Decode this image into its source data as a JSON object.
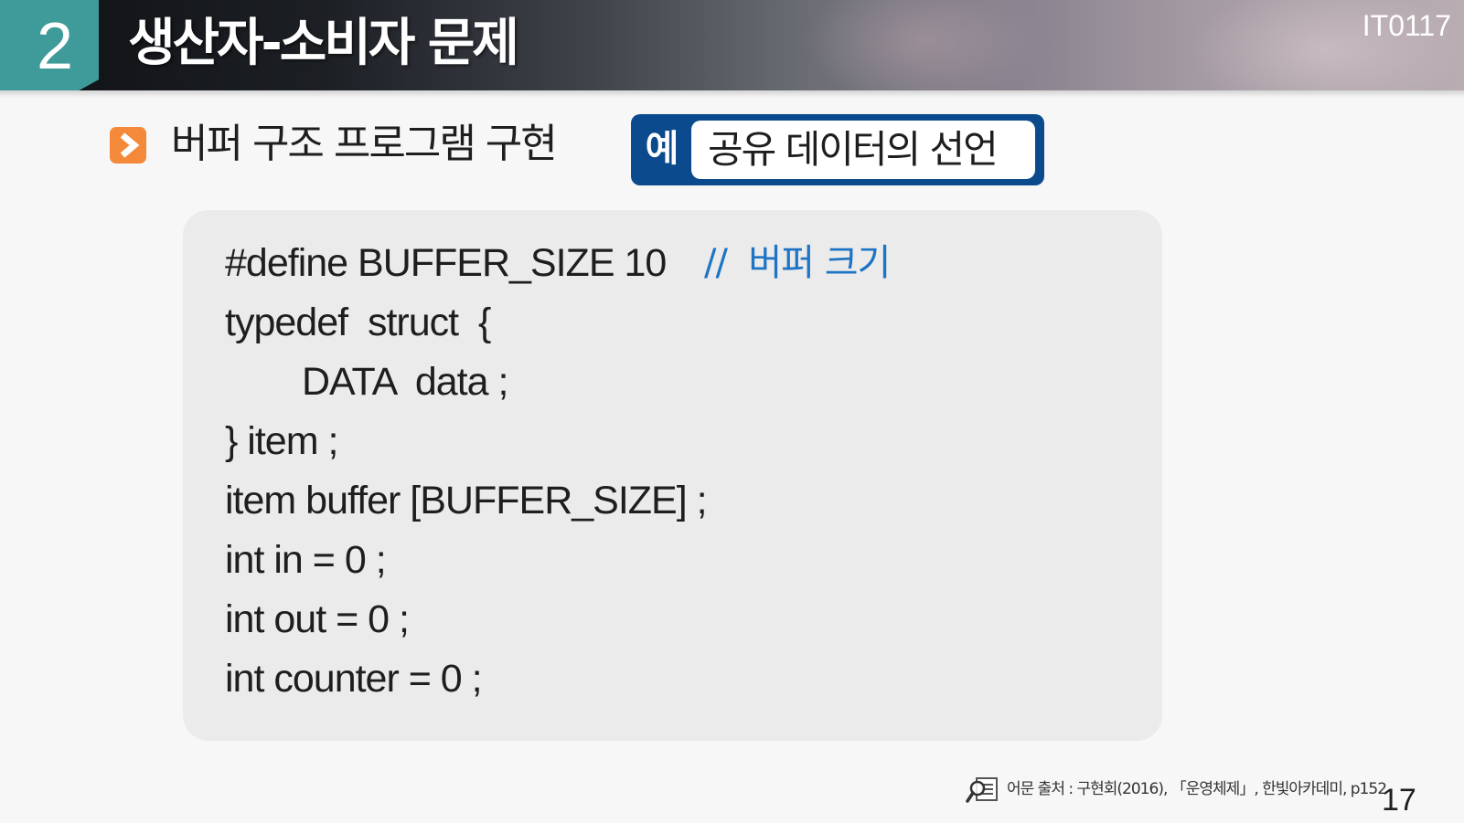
{
  "header": {
    "section_number": "2",
    "title": "생산자-소비자 문제",
    "course_code": "IT0117"
  },
  "subheading": {
    "icon": "chevron-right-icon",
    "text": "버퍼 구조 프로그램 구현"
  },
  "example": {
    "label": "예",
    "content": "공유 데이터의 선언"
  },
  "code": {
    "lines": [
      "#define BUFFER_SIZE 10",
      "typedef  struct  {",
      "DATA  data ;",
      "} item ;",
      "item buffer [BUFFER_SIZE] ;",
      "int in = 0 ;",
      "int out = 0 ;",
      "int counter = 0 ;"
    ],
    "comment": "//  버퍼 크기"
  },
  "footer": {
    "source_icon": "document-magnifier-icon",
    "source": "어문 출처 : 구현회(2016), 「운영체제」, 한빛아카데미, p152",
    "page_number": "17"
  },
  "colors": {
    "section_teal": "#3f9a9a",
    "bullet_orange": "#f5893a",
    "badge_navy": "#0b4a8c",
    "comment_blue": "#1d73c4"
  }
}
